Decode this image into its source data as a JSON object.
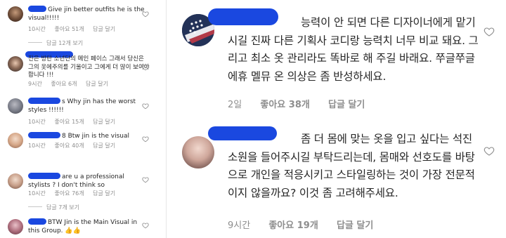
{
  "left_comments": [
    {
      "text": "Give jin better outfits he is the visual!!!!!",
      "time": "10시간",
      "likes": "좋아요 51개",
      "reply": "답글 달기",
      "replies_text": "답글 12개 보기"
    },
    {
      "text": "진은 방탄 소년단의 메인 페이스 그래서 당신은 그의 옷에주의를 기울이고 그에게 더 많이 보여야합니다 !!!",
      "time": "9시간",
      "likes": "좋아요 6개",
      "reply": "답글 달기"
    },
    {
      "text": "s Why jin has the worst styles !!!!!!",
      "time": "10시간",
      "likes": "좋아요 15개",
      "reply": "답글 달기"
    },
    {
      "text": "8 Btw jin is the visual",
      "time": "10시간",
      "likes": "좋아요 40개",
      "reply": "답글 달기"
    },
    {
      "text": "are u a professional stylists ? I don't think so",
      "time": "10시간",
      "likes": "좋아요 76개",
      "reply": "답글 달기",
      "replies_text": "답글 7개 보기"
    },
    {
      "text": "BTW Jin is the Main Visual in this Group. 👍👍",
      "time": "",
      "likes": "",
      "reply": ""
    }
  ],
  "right_comments": [
    {
      "text": "능력이 안 되면 다른 디자이너에게 맡기시길 진짜 다른 기획사 코디랑 능력치 너무 비교 돼요. 그리고 최소 옷 관리라도 똑바로 해 주길 바래요. 쭈글쭈글 에휴 멜뮤 온 의상은 좀 반성하세요.",
      "time": "2일",
      "likes": "좋아요 38개",
      "reply": "답글 달기"
    },
    {
      "text": "좀 더 몸에 맞는 옷을 입고 싶다는 석진 소원을 들어주시길 부탁드리는데, 몸매와 선호도를 바탕으로 개인을 적응시키고 스타일링하는 것이 가장 전문적이지 않을까요? 이것 좀 고려해주세요.",
      "time": "9시간",
      "likes": "좋아요 19개",
      "reply": "답글 달기"
    }
  ],
  "colors": {
    "redaction": "#1a48e0",
    "meta": "#8e8e8e",
    "text": "#262626"
  },
  "icons": [
    "heart-outline-icon",
    "avatar"
  ]
}
